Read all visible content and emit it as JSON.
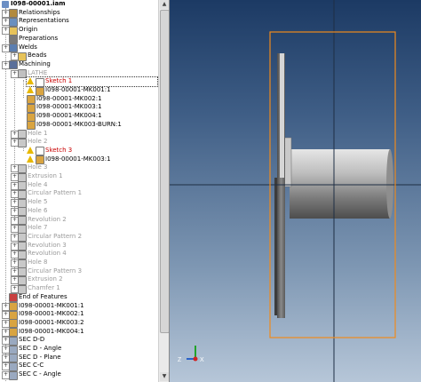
{
  "browser": {
    "root": "I098-00001.iam",
    "items": [
      {
        "label": "Relationships",
        "color": "#000000",
        "icon": "relationships-icon"
      },
      {
        "label": "Representations",
        "color": "#000000",
        "icon": "representations-icon"
      },
      {
        "label": "Origin",
        "color": "#000000",
        "icon": "folder-icon"
      },
      {
        "label": "Preparations",
        "color": "#000000",
        "icon": "preparations-icon"
      },
      {
        "label": "Welds",
        "color": "#000000",
        "icon": "welds-icon"
      },
      {
        "label": "Beads",
        "color": "#000000",
        "icon": "folder-icon"
      },
      {
        "label": "Machining",
        "color": "#000000",
        "icon": "machining-icon"
      },
      {
        "label": "LATHE",
        "color": "#9a9a9a",
        "icon": "lathe-icon"
      },
      {
        "label": "Sketch 1",
        "color": "#c80000",
        "icon": "sketch-icon"
      },
      {
        "label": "I098-00001-MK001:1",
        "color": "#000000",
        "icon": "part-icon"
      },
      {
        "label": "I098-00001-MK002:1",
        "color": "#000000",
        "icon": "part-icon"
      },
      {
        "label": "I098-00001-MK003:1",
        "color": "#000000",
        "icon": "part-icon"
      },
      {
        "label": "I098-00001-MK004:1",
        "color": "#000000",
        "icon": "part-icon"
      },
      {
        "label": "I098-00001-MK003-BURN:1",
        "color": "#000000",
        "icon": "part-icon"
      },
      {
        "label": "Hole 1",
        "color": "#9a9a9a",
        "icon": "hole-icon"
      },
      {
        "label": "Hole 2",
        "color": "#9a9a9a",
        "icon": "hole-icon"
      },
      {
        "label": "Sketch 3",
        "color": "#c80000",
        "icon": "sketch-icon"
      },
      {
        "label": "I098-00001-MK003:1",
        "color": "#000000",
        "icon": "part-icon"
      },
      {
        "label": "Hole 3",
        "color": "#9a9a9a",
        "icon": "hole-icon"
      },
      {
        "label": "Extrusion 1",
        "color": "#9a9a9a",
        "icon": "extrusion-icon"
      },
      {
        "label": "Hole 4",
        "color": "#9a9a9a",
        "icon": "hole-icon"
      },
      {
        "label": "Circular Pattern 1",
        "color": "#9a9a9a",
        "icon": "circular-pattern-icon"
      },
      {
        "label": "Hole 5",
        "color": "#9a9a9a",
        "icon": "hole-icon"
      },
      {
        "label": "Hole 6",
        "color": "#9a9a9a",
        "icon": "hole-icon"
      },
      {
        "label": "Revolution 2",
        "color": "#9a9a9a",
        "icon": "revolution-icon"
      },
      {
        "label": "Hole 7",
        "color": "#9a9a9a",
        "icon": "hole-icon"
      },
      {
        "label": "Circular Pattern 2",
        "color": "#9a9a9a",
        "icon": "circular-pattern-icon"
      },
      {
        "label": "Revolution 3",
        "color": "#9a9a9a",
        "icon": "revolution-icon"
      },
      {
        "label": "Revolution 4",
        "color": "#9a9a9a",
        "icon": "revolution-icon"
      },
      {
        "label": "Hole 8",
        "color": "#9a9a9a",
        "icon": "hole-icon"
      },
      {
        "label": "Circular Pattern 3",
        "color": "#9a9a9a",
        "icon": "circular-pattern-icon"
      },
      {
        "label": "Extrusion 2",
        "color": "#9a9a9a",
        "icon": "extrusion-icon"
      },
      {
        "label": "Chamfer 1",
        "color": "#9a9a9a",
        "icon": "chamfer-icon"
      },
      {
        "label": "End of Features",
        "color": "#000000",
        "icon": "end-of-features-icon"
      },
      {
        "label": "I098-00001-MK001:1",
        "color": "#000000",
        "icon": "part-icon"
      },
      {
        "label": "I098-00001-MK002:1",
        "color": "#000000",
        "icon": "part-icon"
      },
      {
        "label": "I098-00001-MK003:2",
        "color": "#000000",
        "icon": "part-icon"
      },
      {
        "label": "I098-00001-MK004:1",
        "color": "#000000",
        "icon": "part-icon"
      },
      {
        "label": "SEC D-D",
        "color": "#000000",
        "icon": "view-icon"
      },
      {
        "label": "SEC D - Angle",
        "color": "#000000",
        "icon": "view-icon"
      },
      {
        "label": "SEC D - Plane",
        "color": "#000000",
        "icon": "view-icon"
      },
      {
        "label": "SEC C-C",
        "color": "#000000",
        "icon": "view-icon"
      },
      {
        "label": "SEC C - Angle",
        "color": "#000000",
        "icon": "view-icon"
      }
    ]
  },
  "viewport": {
    "triad_x": "X",
    "triad_z": "Z",
    "bbox_color": "#f08a1c",
    "axis_x_color": "#2a62c8",
    "axis_y_color": "#21a32a",
    "axis_z_color": "#d22222"
  }
}
